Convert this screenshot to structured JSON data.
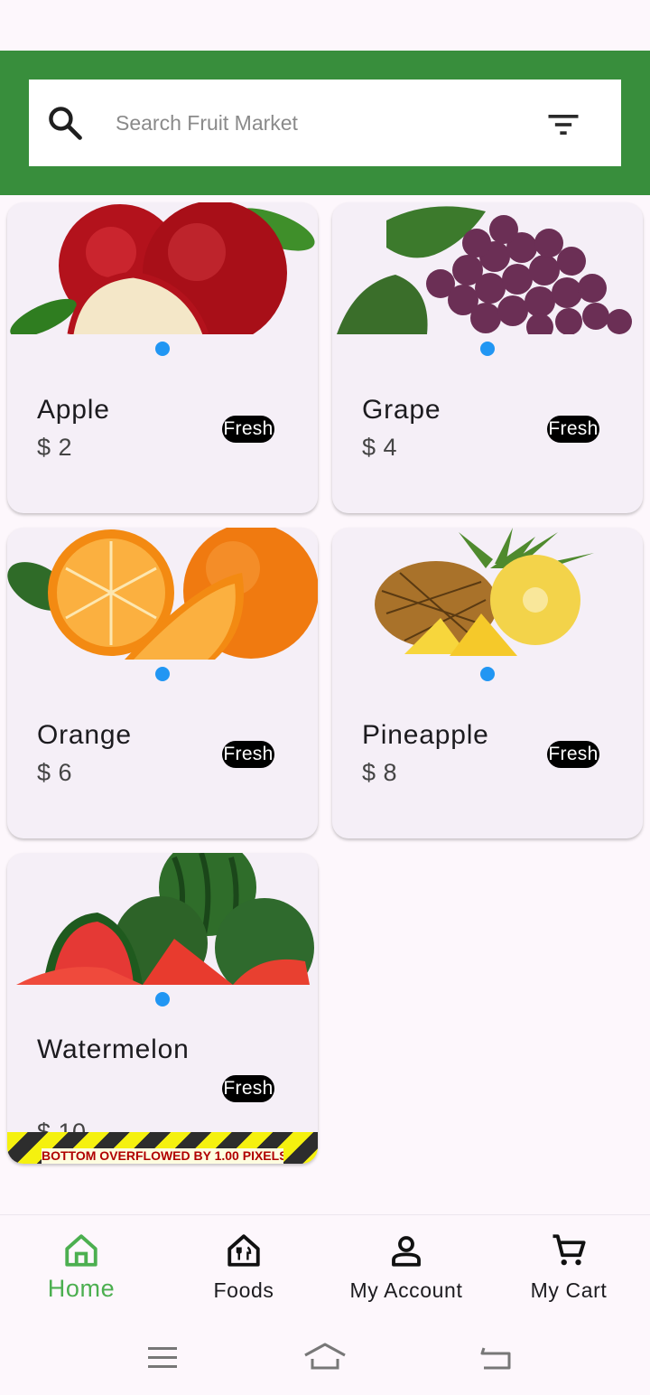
{
  "search": {
    "placeholder": "Search Fruit Market"
  },
  "colors": {
    "app_bar": "#388e3c",
    "active_nav": "#4caf50",
    "indicator_dot": "#2196f3",
    "badge_bg": "#000000",
    "card_bg": "#f5eff7"
  },
  "icons": {
    "search": "search-icon",
    "filter": "filter-icon",
    "home": "home-icon",
    "foods": "foods-icon",
    "account": "account-icon",
    "cart": "cart-icon"
  },
  "products": [
    {
      "name": "Apple",
      "price": "$ 2",
      "badge": "Fresh",
      "image": "apple"
    },
    {
      "name": "Grape",
      "price": "$ 4",
      "badge": "Fresh",
      "image": "grape"
    },
    {
      "name": "Orange",
      "price": "$ 6",
      "badge": "Fresh",
      "image": "orange"
    },
    {
      "name": "Pineapple",
      "price": "$ 8",
      "badge": "Fresh",
      "image": "pineapple"
    },
    {
      "name": "Watermelon",
      "price": "$ 10",
      "badge": "Fresh",
      "image": "watermelon"
    }
  ],
  "overflow_warning": "BOTTOM OVERFLOWED BY 1.00 PIXELS",
  "bottom_nav": {
    "items": [
      {
        "label": "Home",
        "active": true
      },
      {
        "label": "Foods",
        "active": false
      },
      {
        "label": "My Account",
        "active": false
      },
      {
        "label": "My Cart",
        "active": false
      }
    ]
  }
}
